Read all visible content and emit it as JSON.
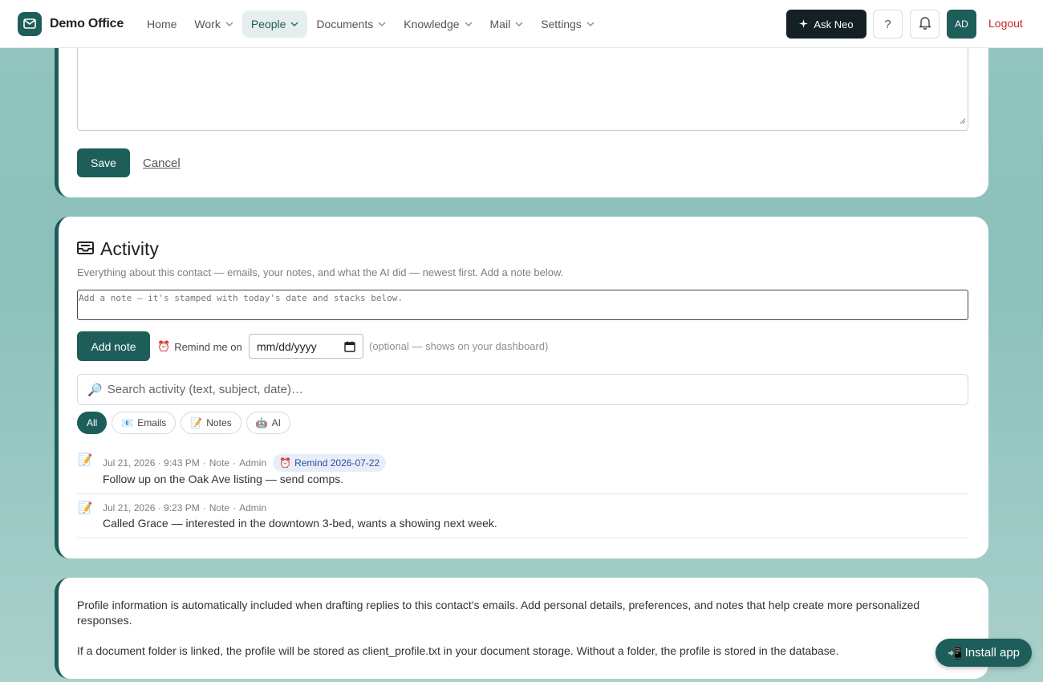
{
  "brand": {
    "name": "Demo Office"
  },
  "nav": {
    "items": [
      {
        "label": "Home",
        "has_menu": false,
        "active": false
      },
      {
        "label": "Work",
        "has_menu": true,
        "active": false
      },
      {
        "label": "People",
        "has_menu": true,
        "active": true
      },
      {
        "label": "Documents",
        "has_menu": true,
        "active": false
      },
      {
        "label": "Knowledge",
        "has_menu": true,
        "active": false
      },
      {
        "label": "Mail",
        "has_menu": true,
        "active": false
      },
      {
        "label": "Settings",
        "has_menu": true,
        "active": false
      }
    ],
    "ask_neo": "Ask Neo",
    "help": "?",
    "avatar": "AD",
    "logout": "Logout"
  },
  "form": {
    "save_label": "Save",
    "cancel_label": "Cancel"
  },
  "activity": {
    "title": "Activity",
    "subtitle": "Everything about this contact — emails, your notes, and what the AI did — newest first. Add a note below.",
    "note_placeholder": "Add a note — it's stamped with today's date and stacks below.",
    "add_note_label": "Add note",
    "remind_label": "Remind me on",
    "date_placeholder": "mm/dd/yyyy",
    "optional_hint": "(optional — shows on your dashboard)",
    "search_placeholder": "Search activity (text, subject, date)…",
    "filters": [
      {
        "label": "All",
        "icon": "",
        "active": true
      },
      {
        "label": "Emails",
        "icon": "📧",
        "active": false
      },
      {
        "label": "Notes",
        "icon": "📝",
        "active": false
      },
      {
        "label": "AI",
        "icon": "🤖",
        "active": false
      }
    ],
    "entries": [
      {
        "icon": "📝",
        "date": "Jul 21, 2026 · 9:43 PM",
        "type": "Note",
        "author": "Admin",
        "remind": "Remind 2026-07-22",
        "text": "Follow up on the Oak Ave listing — send comps."
      },
      {
        "icon": "📝",
        "date": "Jul 21, 2026 · 9:23 PM",
        "type": "Note",
        "author": "Admin",
        "remind": "",
        "text": "Called Grace — interested in the downtown 3-bed, wants a showing next week."
      }
    ]
  },
  "info": {
    "p1": "Profile information is automatically included when drafting replies to this contact's emails. Add personal details, preferences, and notes that help create more personalized responses.",
    "p2": "If a document folder is linked, the profile will be stored as client_profile.txt in your document storage. Without a folder, the profile is stored in the database."
  },
  "install": {
    "label": "Install app",
    "icon": "📲"
  },
  "colors": {
    "accent": "#1d5e5a",
    "dark": "#132126",
    "logout": "#c62828",
    "background": "#8fc2bf"
  }
}
